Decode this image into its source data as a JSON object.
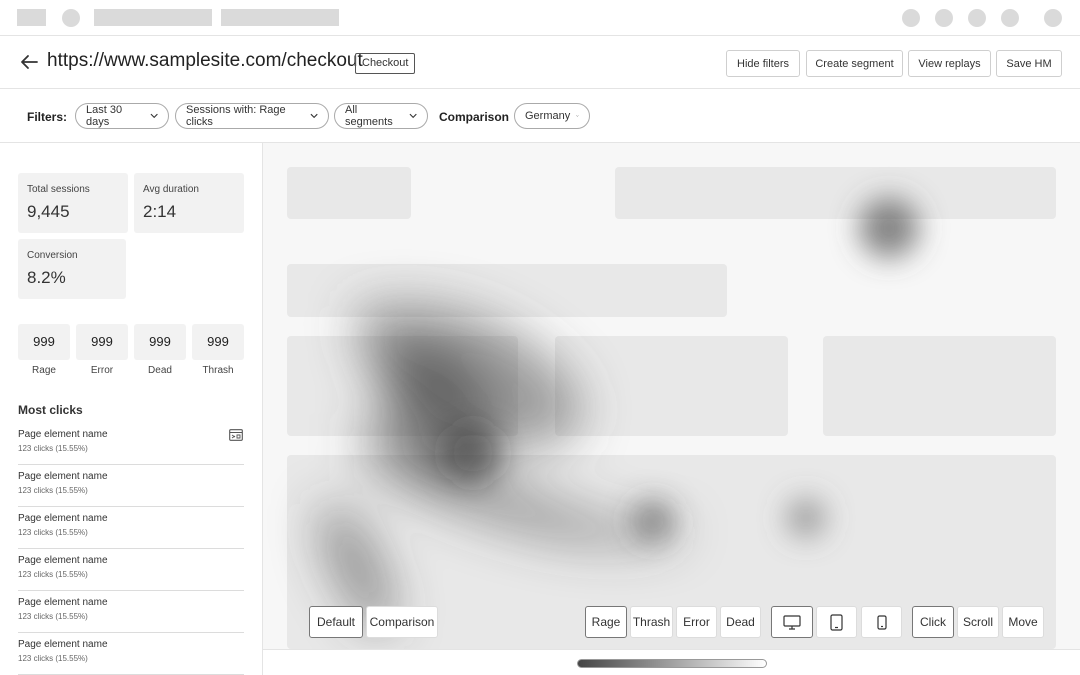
{
  "header": {
    "url": "https://www.samplesite.com/checkout",
    "tag": "Checkout",
    "buttons": {
      "hide_filters": "Hide filters",
      "create_segment": "Create segment",
      "view_replays": "View replays",
      "save_hm": "Save HM"
    }
  },
  "filters": {
    "label": "Filters:",
    "date": "Last 30 days",
    "sessions": "Sessions with: Rage clicks",
    "segments": "All segments",
    "comparison_label": "Comparison",
    "comparison_value": "Germany"
  },
  "stats": {
    "total_sessions": {
      "label": "Total sessions",
      "value": "9,445"
    },
    "avg_duration": {
      "label": "Avg duration",
      "value": "2:14"
    },
    "conversion": {
      "label": "Conversion",
      "value": "8.2%"
    }
  },
  "counters": [
    {
      "value": "999",
      "label": "Rage"
    },
    {
      "value": "999",
      "label": "Error"
    },
    {
      "value": "999",
      "label": "Dead"
    },
    {
      "value": "999",
      "label": "Thrash"
    }
  ],
  "most_clicks": {
    "title": "Most clicks",
    "items": [
      {
        "name": "Page element name",
        "clicks": "123 clicks (15.55%)"
      },
      {
        "name": "Page element name",
        "clicks": "123 clicks (15.55%)"
      },
      {
        "name": "Page element name",
        "clicks": "123 clicks (15.55%)"
      },
      {
        "name": "Page element name",
        "clicks": "123 clicks (15.55%)"
      },
      {
        "name": "Page element name",
        "clicks": "123 clicks (15.55%)"
      },
      {
        "name": "Page element name",
        "clicks": "123 clicks (15.55%)"
      }
    ]
  },
  "toolbar": {
    "default": "Default",
    "comparison": "Comparison",
    "rage": "Rage",
    "thrash": "Thrash",
    "error": "Error",
    "dead": "Dead",
    "click": "Click",
    "scroll": "Scroll",
    "move": "Move"
  },
  "icons": {
    "back": "arrow-left-icon",
    "chevron": "chevron-down-icon",
    "element": "element-preview-icon",
    "desktop": "desktop-icon",
    "tablet": "tablet-icon",
    "mobile": "mobile-icon"
  },
  "colors": {
    "skeleton": "#dadada",
    "panel": "#f2f2f2",
    "block": "#e8e8e8",
    "border": "#cfcfcf"
  }
}
